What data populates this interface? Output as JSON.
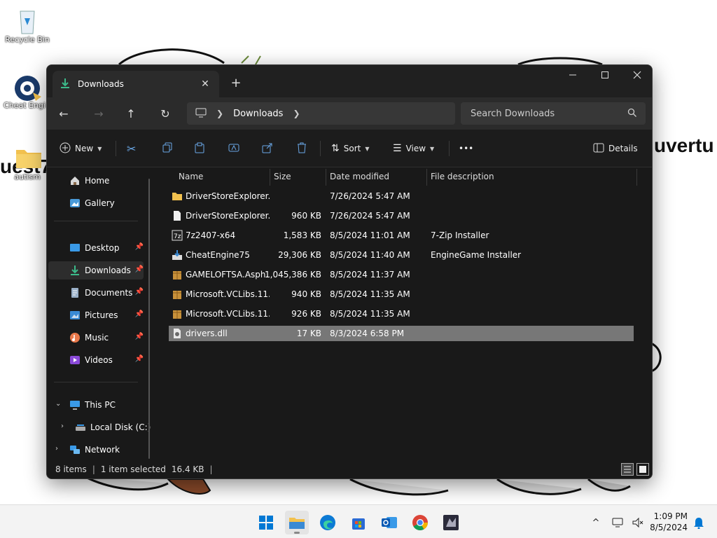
{
  "desktop": {
    "icons": [
      {
        "label": "Recycle Bin"
      },
      {
        "label": "Cheat Engi"
      },
      {
        "label": "autism"
      }
    ],
    "wall_text_left": "uest7",
    "wall_text_right": "uvertu"
  },
  "window": {
    "tab_title": "Downloads",
    "new_tab": "+",
    "address": {
      "crumb": "Downloads"
    },
    "search_placeholder": "Search Downloads",
    "toolbar": {
      "new_label": "New",
      "sort_label": "Sort",
      "view_label": "View",
      "more_label": "•••",
      "details_label": "Details"
    },
    "sidebar": {
      "items": [
        {
          "label": "Home"
        },
        {
          "label": "Gallery"
        },
        {
          "label": "Desktop"
        },
        {
          "label": "Downloads"
        },
        {
          "label": "Documents"
        },
        {
          "label": "Pictures"
        },
        {
          "label": "Music"
        },
        {
          "label": "Videos"
        },
        {
          "label": "This PC"
        },
        {
          "label": "Local Disk (C:)"
        },
        {
          "label": "Network"
        }
      ]
    },
    "columns": {
      "name": "Name",
      "size": "Size",
      "date": "Date modified",
      "desc": "File description"
    },
    "files": [
      {
        "name": "DriverStoreExplorer....",
        "size": "",
        "date": "7/26/2024 5:47 AM",
        "desc": "",
        "icon": "folder-icon"
      },
      {
        "name": "DriverStoreExplorer....",
        "size": "960 KB",
        "date": "7/26/2024 5:47 AM",
        "desc": "",
        "icon": "file-icon"
      },
      {
        "name": "7z2407-x64",
        "size": "1,583 KB",
        "date": "8/5/2024 11:01 AM",
        "desc": "7-Zip Installer",
        "icon": "7zip-icon"
      },
      {
        "name": "CheatEngine75",
        "size": "29,306 KB",
        "date": "8/5/2024 11:40 AM",
        "desc": "EngineGame Installer",
        "icon": "installer-icon"
      },
      {
        "name": "GAMELOFTSA.Asph...",
        "size": "1,045,386 KB",
        "date": "8/5/2024 11:37 AM",
        "desc": "",
        "icon": "package-icon"
      },
      {
        "name": "Microsoft.VCLibs.11...",
        "size": "940 KB",
        "date": "8/5/2024 11:35 AM",
        "desc": "",
        "icon": "package-icon"
      },
      {
        "name": "Microsoft.VCLibs.11...",
        "size": "926 KB",
        "date": "8/5/2024 11:35 AM",
        "desc": "",
        "icon": "package-icon"
      },
      {
        "name": "drivers.dll",
        "size": "17 KB",
        "date": "8/3/2024 6:58 PM",
        "desc": "",
        "icon": "dll-icon"
      }
    ],
    "status": {
      "count": "8 items",
      "selected": "1 item selected",
      "size": "16.4 KB",
      "sep": "|"
    }
  },
  "taskbar": {
    "time": "1:09 PM",
    "date": "8/5/2024",
    "tray_chevron": "^"
  },
  "colors": {
    "accent": "#0078d4",
    "folder": "#f2c14e",
    "selection": "#777777"
  }
}
